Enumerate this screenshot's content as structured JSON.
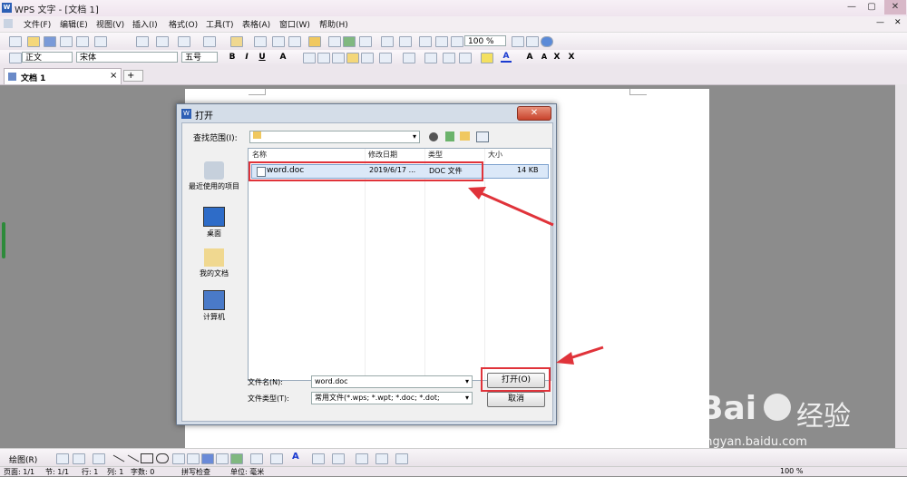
{
  "app": {
    "title": "WPS 文字 - [文档 1]",
    "logo": "W"
  },
  "window_controls": [
    "—",
    "▢",
    "✕"
  ],
  "menu": {
    "items": [
      "文件(F)",
      "编辑(E)",
      "视图(V)",
      "插入(I)",
      "格式(O)",
      "工具(T)",
      "表格(A)",
      "窗口(W)",
      "帮助(H)"
    ],
    "right_close": "✕",
    "right_min": "—"
  },
  "toolbar": {
    "zoom": "100 %"
  },
  "format_bar": {
    "style": "正文",
    "font": "宋体",
    "size": "五号",
    "bold": "B",
    "italic": "I",
    "underline": "U",
    "char_a": "A",
    "grow": "A",
    "shrink": "A",
    "superscript": "X",
    "subscript": "X"
  },
  "tabs": {
    "doc_tab": "文档 1",
    "close": "×",
    "add": "+"
  },
  "dialog": {
    "title": "打开",
    "close": "✕",
    "lookin_label": "查找范围(I):",
    "lookin_value": "",
    "places": [
      "最近使用的项目",
      "桌面",
      "我的文档",
      "计算机"
    ],
    "columns": [
      "名称",
      "修改日期",
      "类型",
      "大小"
    ],
    "files": [
      {
        "name": "word.doc",
        "date": "2019/6/17 ...",
        "type": "DOC 文件",
        "size": "14 KB"
      }
    ],
    "filename_label": "文件名(N):",
    "filename_value": "word.doc",
    "filetype_label": "文件类型(T):",
    "filetype_value": "常用文件(*.wps; *.wpt; *.doc; *.dot;",
    "open_button": "打开(O)",
    "cancel_button": "取消"
  },
  "drawbar": {
    "draw_label": "绘图(R)"
  },
  "statusbar": {
    "items": [
      "页面: 1/1",
      "节: 1/1",
      "行: 1",
      "列: 1",
      "字数: 0",
      "拼写检查",
      "单位: 毫米"
    ],
    "zoom": "100 %"
  },
  "watermark": {
    "brand": "Bai",
    "brand2": "经验",
    "url": "jingyan.baidu.com"
  },
  "colors": {
    "annotation_red": "#e0333a",
    "selection_blue": "#dbe8f8"
  }
}
